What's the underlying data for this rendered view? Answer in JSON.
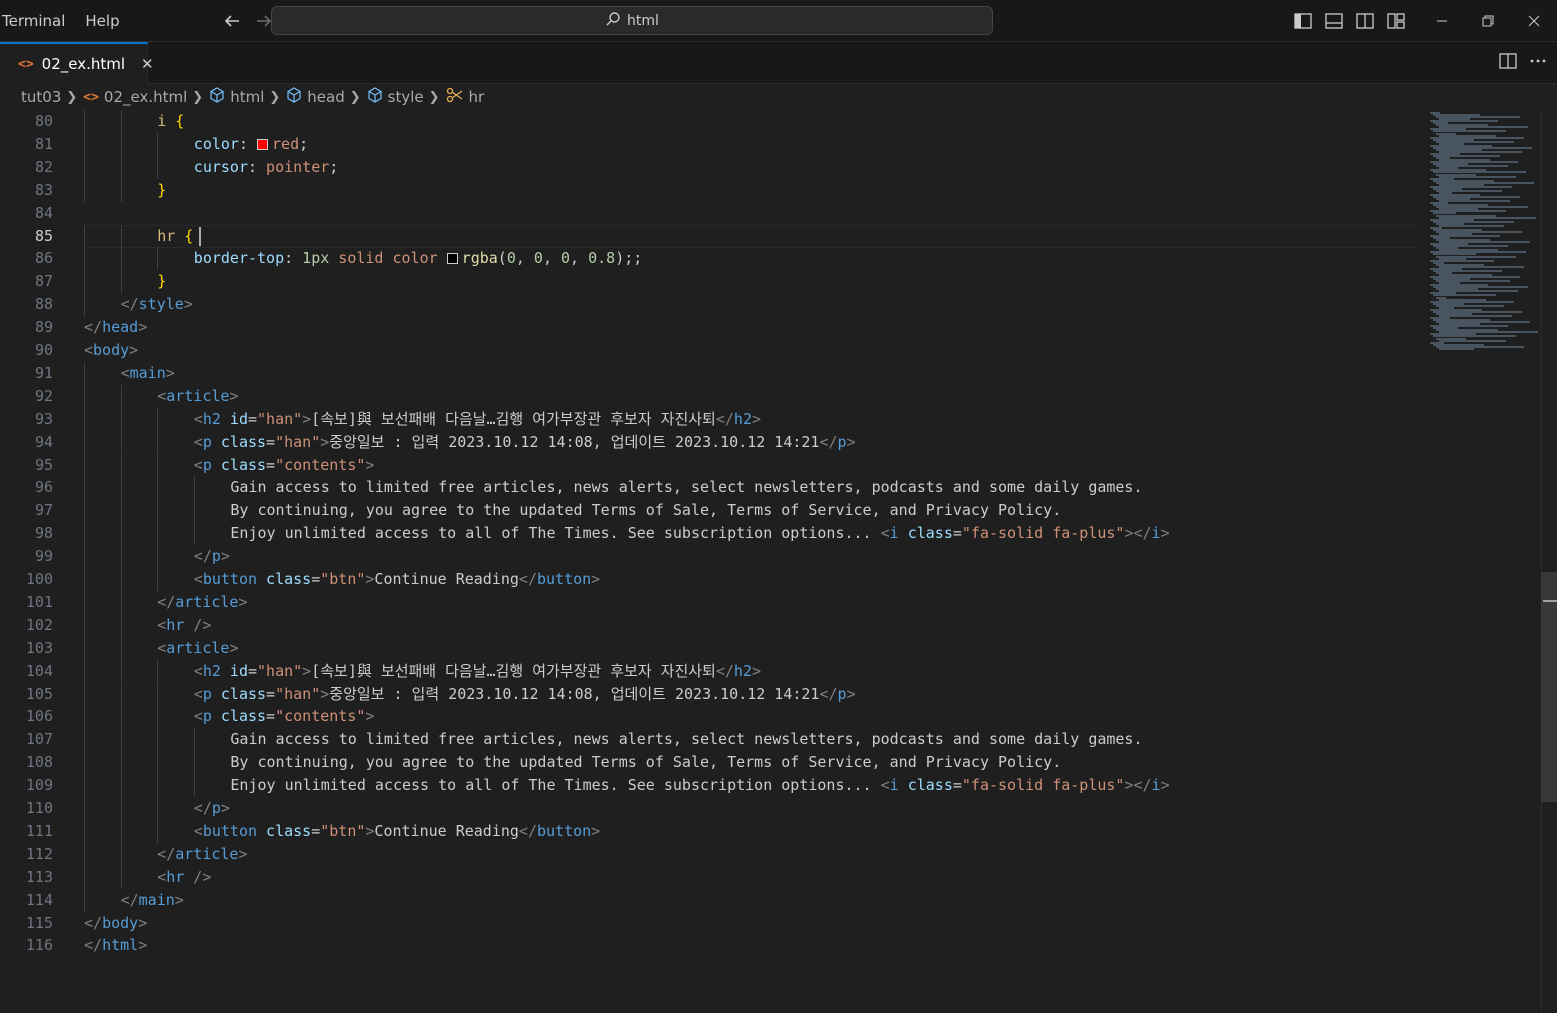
{
  "menu": {
    "items": [
      "Terminal",
      "Help"
    ]
  },
  "search": {
    "text": "html"
  },
  "tab": {
    "file_icon": "<>",
    "label": "02_ex.html",
    "close": "✕"
  },
  "breadcrumb": {
    "items": [
      {
        "label": "tut03",
        "icon": ""
      },
      {
        "label": "02_ex.html",
        "icon": "html-file-icon"
      },
      {
        "label": "html",
        "icon": "element-icon"
      },
      {
        "label": "head",
        "icon": "element-icon"
      },
      {
        "label": "style",
        "icon": "element-icon"
      },
      {
        "label": "hr",
        "icon": "css-rule-icon"
      }
    ]
  },
  "editor": {
    "first_line": 80,
    "active_line": 85,
    "lines": [
      {
        "n": "80",
        "indent": 2,
        "tokens": [
          [
            "sel",
            "i "
          ],
          [
            "brace",
            "{"
          ]
        ]
      },
      {
        "n": "81",
        "indent": 3,
        "tokens": [
          [
            "prop",
            "color"
          ],
          [
            "plain",
            ": "
          ],
          [
            "swatch",
            "#ff0000"
          ],
          [
            "val",
            "red"
          ],
          [
            "plain",
            ";"
          ]
        ]
      },
      {
        "n": "82",
        "indent": 3,
        "tokens": [
          [
            "prop",
            "cursor"
          ],
          [
            "plain",
            ": "
          ],
          [
            "val",
            "pointer"
          ],
          [
            "plain",
            ";"
          ]
        ]
      },
      {
        "n": "83",
        "indent": 2,
        "tokens": [
          [
            "brace",
            "}"
          ]
        ]
      },
      {
        "n": "84",
        "indent": 0,
        "tokens": []
      },
      {
        "n": "85",
        "indent": 2,
        "tokens": [
          [
            "sel",
            "hr "
          ],
          [
            "brace",
            "{"
          ],
          [
            "cursor",
            ""
          ]
        ]
      },
      {
        "n": "86",
        "indent": 3,
        "tokens": [
          [
            "prop",
            "border-top"
          ],
          [
            "plain",
            ": "
          ],
          [
            "num",
            "1px"
          ],
          [
            "val",
            " solid"
          ],
          [
            "val",
            " color "
          ],
          [
            "swatch",
            "#000000"
          ],
          [
            "fn",
            "rgba"
          ],
          [
            "plain",
            "("
          ],
          [
            "num",
            "0"
          ],
          [
            "plain",
            ", "
          ],
          [
            "num",
            "0"
          ],
          [
            "plain",
            ", "
          ],
          [
            "num",
            "0"
          ],
          [
            "plain",
            ", "
          ],
          [
            "num",
            "0.8"
          ],
          [
            "plain",
            ");;"
          ]
        ]
      },
      {
        "n": "87",
        "indent": 2,
        "tokens": [
          [
            "brace",
            "}"
          ]
        ]
      },
      {
        "n": "88",
        "indent": 1,
        "tokens": [
          [
            "br",
            "</"
          ],
          [
            "tag",
            "style"
          ],
          [
            "br",
            ">"
          ]
        ]
      },
      {
        "n": "89",
        "indent": 0,
        "tokens": [
          [
            "br",
            "</"
          ],
          [
            "tag",
            "head"
          ],
          [
            "br",
            ">"
          ]
        ]
      },
      {
        "n": "90",
        "indent": 0,
        "tokens": [
          [
            "br",
            "<"
          ],
          [
            "tag",
            "body"
          ],
          [
            "br",
            ">"
          ]
        ]
      },
      {
        "n": "91",
        "indent": 1,
        "tokens": [
          [
            "br",
            "<"
          ],
          [
            "tag",
            "main"
          ],
          [
            "br",
            ">"
          ]
        ]
      },
      {
        "n": "92",
        "indent": 2,
        "tokens": [
          [
            "br",
            "<"
          ],
          [
            "tag",
            "article"
          ],
          [
            "br",
            ">"
          ]
        ]
      },
      {
        "n": "93",
        "indent": 3,
        "tokens": [
          [
            "br",
            "<"
          ],
          [
            "tag",
            "h2"
          ],
          [
            "attr",
            " id"
          ],
          [
            "plain",
            "="
          ],
          [
            "str",
            "\"han\""
          ],
          [
            "br",
            ">"
          ],
          [
            "plain",
            "[속보]與 보선패배 다음날…김행 여가부장관 후보자 자진사퇴"
          ],
          [
            "br",
            "</"
          ],
          [
            "tag",
            "h2"
          ],
          [
            "br",
            ">"
          ]
        ]
      },
      {
        "n": "94",
        "indent": 3,
        "tokens": [
          [
            "br",
            "<"
          ],
          [
            "tag",
            "p"
          ],
          [
            "attr",
            " class"
          ],
          [
            "plain",
            "="
          ],
          [
            "str",
            "\"han\""
          ],
          [
            "br",
            ">"
          ],
          [
            "plain",
            "중앙일보 : 입력 2023.10.12 14:08, 업데이트 2023.10.12 14:21"
          ],
          [
            "br",
            "</"
          ],
          [
            "tag",
            "p"
          ],
          [
            "br",
            ">"
          ]
        ]
      },
      {
        "n": "95",
        "indent": 3,
        "tokens": [
          [
            "br",
            "<"
          ],
          [
            "tag",
            "p"
          ],
          [
            "attr",
            " class"
          ],
          [
            "plain",
            "="
          ],
          [
            "str",
            "\"contents\""
          ],
          [
            "br",
            ">"
          ]
        ]
      },
      {
        "n": "96",
        "indent": 4,
        "tokens": [
          [
            "plain",
            "Gain access to limited free articles, news alerts, select newsletters, podcasts and some daily games."
          ]
        ]
      },
      {
        "n": "97",
        "indent": 4,
        "tokens": [
          [
            "plain",
            "By continuing, you agree to the updated Terms of Sale, Terms of Service, and Privacy Policy."
          ]
        ]
      },
      {
        "n": "98",
        "indent": 4,
        "tokens": [
          [
            "plain",
            "Enjoy unlimited access to all of The Times. See subscription options... "
          ],
          [
            "br",
            "<"
          ],
          [
            "tag",
            "i"
          ],
          [
            "attr",
            " class"
          ],
          [
            "plain",
            "="
          ],
          [
            "str",
            "\"fa-solid fa-plus\""
          ],
          [
            "br",
            "></"
          ],
          [
            "tag",
            "i"
          ],
          [
            "br",
            ">"
          ]
        ]
      },
      {
        "n": "99",
        "indent": 3,
        "tokens": [
          [
            "br",
            "</"
          ],
          [
            "tag",
            "p"
          ],
          [
            "br",
            ">"
          ]
        ]
      },
      {
        "n": "100",
        "indent": 3,
        "tokens": [
          [
            "br",
            "<"
          ],
          [
            "tag",
            "button"
          ],
          [
            "attr",
            " class"
          ],
          [
            "plain",
            "="
          ],
          [
            "str",
            "\"btn\""
          ],
          [
            "br",
            ">"
          ],
          [
            "plain",
            "Continue Reading"
          ],
          [
            "br",
            "</"
          ],
          [
            "tag",
            "button"
          ],
          [
            "br",
            ">"
          ]
        ]
      },
      {
        "n": "101",
        "indent": 2,
        "tokens": [
          [
            "br",
            "</"
          ],
          [
            "tag",
            "article"
          ],
          [
            "br",
            ">"
          ]
        ]
      },
      {
        "n": "102",
        "indent": 2,
        "tokens": [
          [
            "br",
            "<"
          ],
          [
            "tag",
            "hr"
          ],
          [
            "br",
            " />"
          ]
        ]
      },
      {
        "n": "103",
        "indent": 2,
        "tokens": [
          [
            "br",
            "<"
          ],
          [
            "tag",
            "article"
          ],
          [
            "br",
            ">"
          ]
        ]
      },
      {
        "n": "104",
        "indent": 3,
        "tokens": [
          [
            "br",
            "<"
          ],
          [
            "tag",
            "h2"
          ],
          [
            "attr",
            " id"
          ],
          [
            "plain",
            "="
          ],
          [
            "str",
            "\"han\""
          ],
          [
            "br",
            ">"
          ],
          [
            "plain",
            "[속보]與 보선패배 다음날…김행 여가부장관 후보자 자진사퇴"
          ],
          [
            "br",
            "</"
          ],
          [
            "tag",
            "h2"
          ],
          [
            "br",
            ">"
          ]
        ]
      },
      {
        "n": "105",
        "indent": 3,
        "tokens": [
          [
            "br",
            "<"
          ],
          [
            "tag",
            "p"
          ],
          [
            "attr",
            " class"
          ],
          [
            "plain",
            "="
          ],
          [
            "str",
            "\"han\""
          ],
          [
            "br",
            ">"
          ],
          [
            "plain",
            "중앙일보 : 입력 2023.10.12 14:08, 업데이트 2023.10.12 14:21"
          ],
          [
            "br",
            "</"
          ],
          [
            "tag",
            "p"
          ],
          [
            "br",
            ">"
          ]
        ]
      },
      {
        "n": "106",
        "indent": 3,
        "tokens": [
          [
            "br",
            "<"
          ],
          [
            "tag",
            "p"
          ],
          [
            "attr",
            " class"
          ],
          [
            "plain",
            "="
          ],
          [
            "str",
            "\"contents\""
          ],
          [
            "br",
            ">"
          ]
        ]
      },
      {
        "n": "107",
        "indent": 4,
        "tokens": [
          [
            "plain",
            "Gain access to limited free articles, news alerts, select newsletters, podcasts and some daily games."
          ]
        ]
      },
      {
        "n": "108",
        "indent": 4,
        "tokens": [
          [
            "plain",
            "By continuing, you agree to the updated Terms of Sale, Terms of Service, and Privacy Policy."
          ]
        ]
      },
      {
        "n": "109",
        "indent": 4,
        "tokens": [
          [
            "plain",
            "Enjoy unlimited access to all of The Times. See subscription options... "
          ],
          [
            "br",
            "<"
          ],
          [
            "tag",
            "i"
          ],
          [
            "attr",
            " class"
          ],
          [
            "plain",
            "="
          ],
          [
            "str",
            "\"fa-solid fa-plus\""
          ],
          [
            "br",
            "></"
          ],
          [
            "tag",
            "i"
          ],
          [
            "br",
            ">"
          ]
        ]
      },
      {
        "n": "110",
        "indent": 3,
        "tokens": [
          [
            "br",
            "</"
          ],
          [
            "tag",
            "p"
          ],
          [
            "br",
            ">"
          ]
        ]
      },
      {
        "n": "111",
        "indent": 3,
        "tokens": [
          [
            "br",
            "<"
          ],
          [
            "tag",
            "button"
          ],
          [
            "attr",
            " class"
          ],
          [
            "plain",
            "="
          ],
          [
            "str",
            "\"btn\""
          ],
          [
            "br",
            ">"
          ],
          [
            "plain",
            "Continue Reading"
          ],
          [
            "br",
            "</"
          ],
          [
            "tag",
            "button"
          ],
          [
            "br",
            ">"
          ]
        ]
      },
      {
        "n": "112",
        "indent": 2,
        "tokens": [
          [
            "br",
            "</"
          ],
          [
            "tag",
            "article"
          ],
          [
            "br",
            ">"
          ]
        ]
      },
      {
        "n": "113",
        "indent": 2,
        "tokens": [
          [
            "br",
            "<"
          ],
          [
            "tag",
            "hr"
          ],
          [
            "br",
            " />"
          ]
        ]
      },
      {
        "n": "114",
        "indent": 1,
        "tokens": [
          [
            "br",
            "</"
          ],
          [
            "tag",
            "main"
          ],
          [
            "br",
            ">"
          ]
        ]
      },
      {
        "n": "115",
        "indent": 0,
        "tokens": [
          [
            "br",
            "</"
          ],
          [
            "tag",
            "body"
          ],
          [
            "br",
            ">"
          ]
        ]
      },
      {
        "n": "116",
        "indent": 0,
        "tokens": [
          [
            "br",
            "</"
          ],
          [
            "tag",
            "html"
          ],
          [
            "br",
            ">"
          ]
        ]
      }
    ]
  },
  "colors": {
    "accent": "#0078d4",
    "tag": "#569cd6",
    "attr": "#9cdcfe",
    "string": "#ce9178",
    "selector": "#d7ba7d",
    "brace": "#ffd700"
  }
}
